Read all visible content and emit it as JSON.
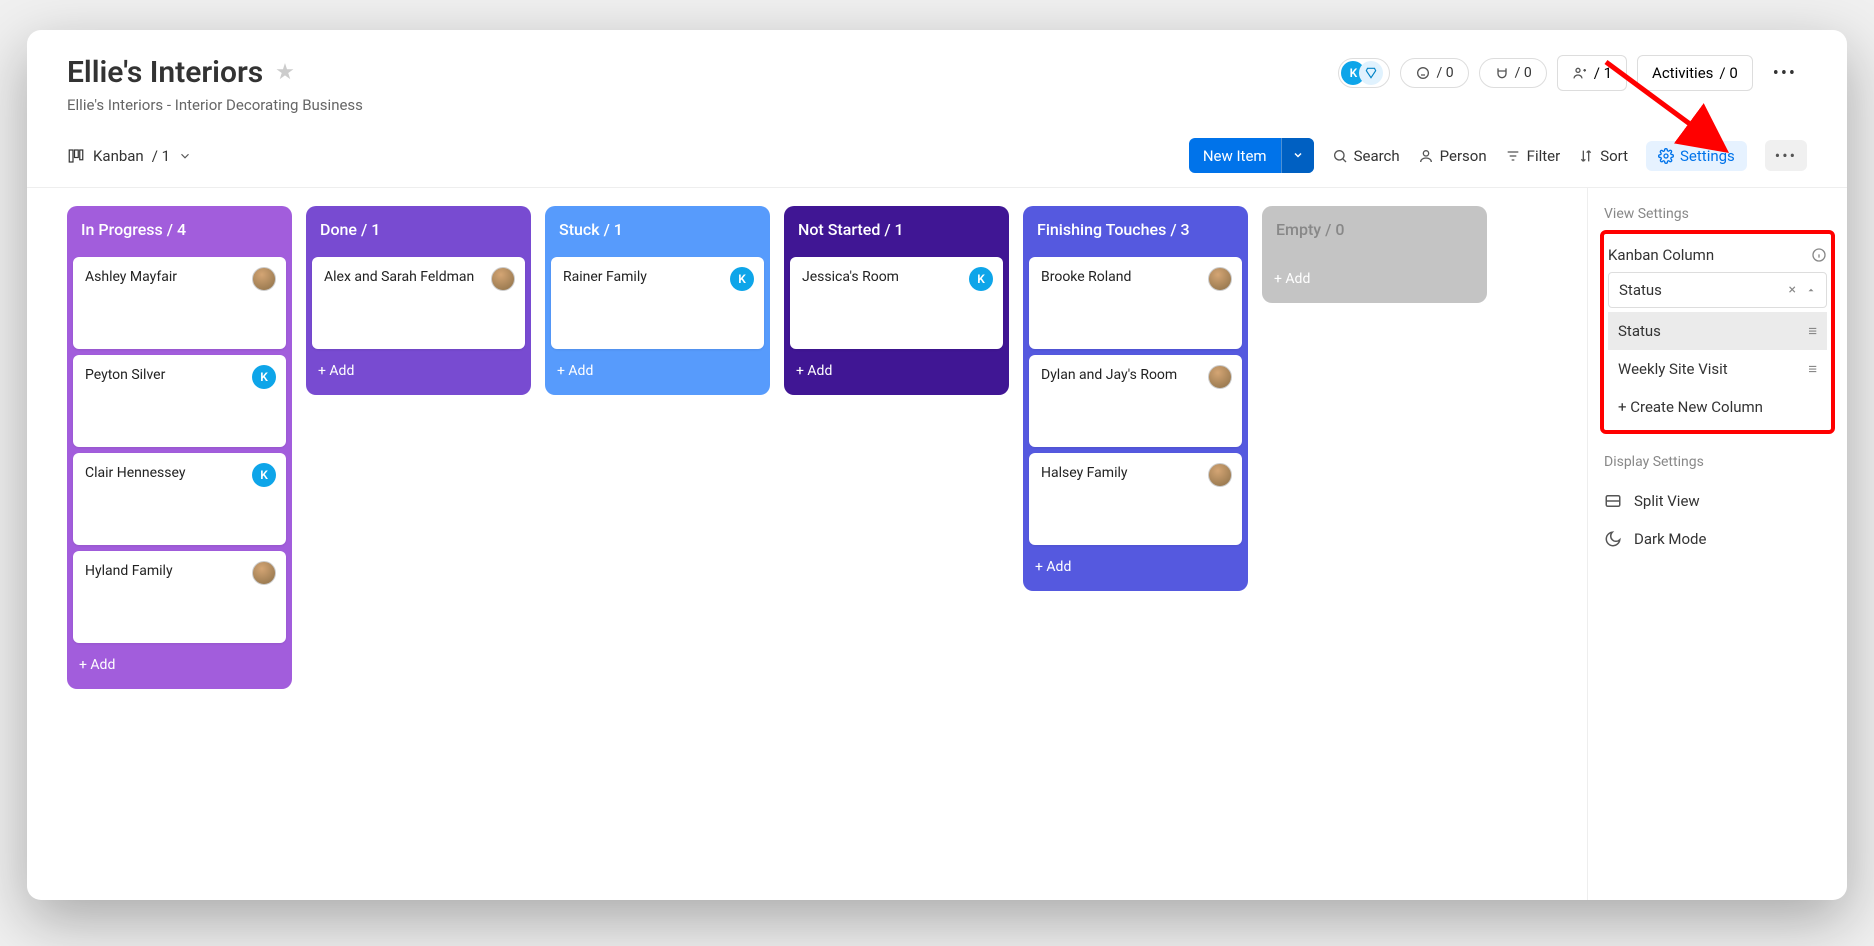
{
  "title": "Ellie's Interiors",
  "subtitle": "Ellie's Interiors - Interior Decorating Business",
  "header_pills": {
    "automation": {
      "count": "0"
    },
    "integration": {
      "count": "0"
    },
    "members": {
      "count": "1"
    },
    "activities": {
      "label": "Activities",
      "count": "0"
    }
  },
  "view_tab": {
    "name": "Kanban",
    "count": "1"
  },
  "toolbar": {
    "new_item": "New Item",
    "search": "Search",
    "person": "Person",
    "filter": "Filter",
    "sort": "Sort",
    "settings": "Settings"
  },
  "columns": [
    {
      "name": "In Progress",
      "count": "4",
      "cls": "c-progress",
      "cards": [
        {
          "title": "Ashley Mayfair",
          "avatar": "img"
        },
        {
          "title": "Peyton Silver",
          "avatar": "K"
        },
        {
          "title": "Clair Hennessey",
          "avatar": "K"
        },
        {
          "title": "Hyland Family",
          "avatar": "img"
        }
      ]
    },
    {
      "name": "Done",
      "count": "1",
      "cls": "c-done",
      "cards": [
        {
          "title": "Alex and Sarah Feldman",
          "avatar": "img"
        }
      ]
    },
    {
      "name": "Stuck",
      "count": "1",
      "cls": "c-stuck",
      "cards": [
        {
          "title": "Rainer Family",
          "avatar": "K"
        }
      ]
    },
    {
      "name": "Not Started",
      "count": "1",
      "cls": "c-nostart",
      "cards": [
        {
          "title": "Jessica's Room",
          "avatar": "K"
        }
      ]
    },
    {
      "name": "Finishing Touches",
      "count": "3",
      "cls": "c-finish",
      "cards": [
        {
          "title": "Brooke Roland",
          "avatar": "img"
        },
        {
          "title": "Dylan and Jay's Room",
          "avatar": "img"
        },
        {
          "title": "Halsey Family",
          "avatar": "img"
        }
      ]
    },
    {
      "name": "Empty",
      "count": "0",
      "cls": "c-empty",
      "empty": true,
      "cards": []
    }
  ],
  "add_label": "+ Add",
  "settings_panel": {
    "view_heading": "View Settings",
    "kanban_column_label": "Kanban Column",
    "selected": "Status",
    "options": [
      {
        "label": "Status",
        "selected": true
      },
      {
        "label": "Weekly Site Visit",
        "selected": false
      }
    ],
    "create_new": "+ Create New Column",
    "display_heading": "Display Settings",
    "split_view": "Split View",
    "dark_mode": "Dark Mode"
  }
}
